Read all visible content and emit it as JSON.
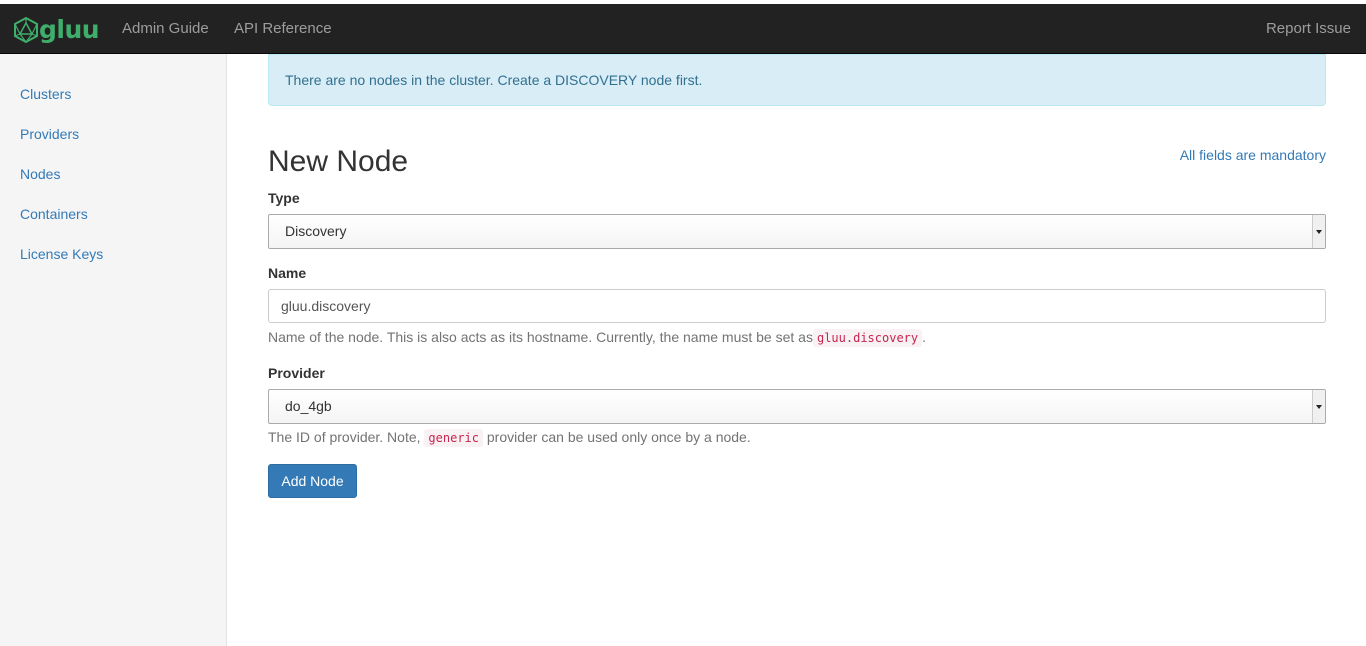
{
  "navbar": {
    "brand": "gluu",
    "links": [
      "Admin Guide",
      "API Reference"
    ],
    "right_link": "Report Issue"
  },
  "sidebar": {
    "items": [
      "Clusters",
      "Providers",
      "Nodes",
      "Containers",
      "License Keys"
    ]
  },
  "alert": {
    "message": "There are no nodes in the cluster. Create a DISCOVERY node first."
  },
  "form": {
    "title": "New Node",
    "note": "All fields are mandatory",
    "type": {
      "label": "Type",
      "selected": "Discovery"
    },
    "name": {
      "label": "Name",
      "value": "gluu.discovery",
      "help_prefix": "Name of the node. This is also acts as its hostname. Currently, the name must be set as",
      "help_code": "gluu.discovery",
      "help_suffix": "."
    },
    "provider": {
      "label": "Provider",
      "selected": "do_4gb",
      "help_prefix": "The ID of provider. Note,",
      "help_code": "generic",
      "help_suffix": "provider can be used only once by a node."
    },
    "submit_label": "Add Node"
  },
  "colors": {
    "navbar_bg": "#222222",
    "brand": "#3fae6a",
    "link": "#337ab7",
    "alert_bg": "#d9edf7",
    "alert_text": "#31708f",
    "button": "#337ab7",
    "code_text": "#c7254e"
  },
  "icons": {
    "brand_logo": "icosahedron-logo-icon",
    "select_arrow": "caret-down-icon"
  }
}
